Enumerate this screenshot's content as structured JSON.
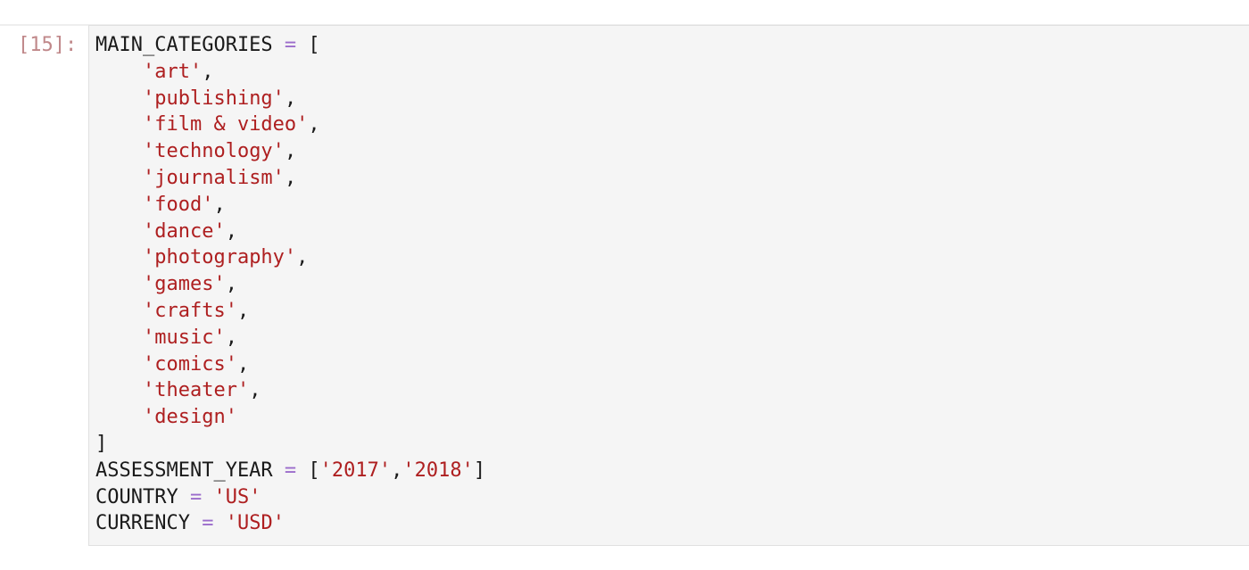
{
  "cell": {
    "prompt": "[15]:",
    "lines": [
      [
        {
          "t": "MAIN_CATEGORIES ",
          "c": "pn"
        },
        {
          "t": "=",
          "c": "op"
        },
        {
          "t": " [",
          "c": "pn"
        }
      ],
      [
        {
          "t": "    ",
          "c": "pn"
        },
        {
          "t": "'art'",
          "c": "str"
        },
        {
          "t": ",",
          "c": "pn"
        }
      ],
      [
        {
          "t": "    ",
          "c": "pn"
        },
        {
          "t": "'publishing'",
          "c": "str"
        },
        {
          "t": ",",
          "c": "pn"
        }
      ],
      [
        {
          "t": "    ",
          "c": "pn"
        },
        {
          "t": "'film & video'",
          "c": "str"
        },
        {
          "t": ",",
          "c": "pn"
        }
      ],
      [
        {
          "t": "    ",
          "c": "pn"
        },
        {
          "t": "'technology'",
          "c": "str"
        },
        {
          "t": ",",
          "c": "pn"
        }
      ],
      [
        {
          "t": "    ",
          "c": "pn"
        },
        {
          "t": "'journalism'",
          "c": "str"
        },
        {
          "t": ",",
          "c": "pn"
        }
      ],
      [
        {
          "t": "    ",
          "c": "pn"
        },
        {
          "t": "'food'",
          "c": "str"
        },
        {
          "t": ",",
          "c": "pn"
        }
      ],
      [
        {
          "t": "    ",
          "c": "pn"
        },
        {
          "t": "'dance'",
          "c": "str"
        },
        {
          "t": ",",
          "c": "pn"
        }
      ],
      [
        {
          "t": "    ",
          "c": "pn"
        },
        {
          "t": "'photography'",
          "c": "str"
        },
        {
          "t": ",",
          "c": "pn"
        }
      ],
      [
        {
          "t": "    ",
          "c": "pn"
        },
        {
          "t": "'games'",
          "c": "str"
        },
        {
          "t": ",",
          "c": "pn"
        }
      ],
      [
        {
          "t": "    ",
          "c": "pn"
        },
        {
          "t": "'crafts'",
          "c": "str"
        },
        {
          "t": ",",
          "c": "pn"
        }
      ],
      [
        {
          "t": "    ",
          "c": "pn"
        },
        {
          "t": "'music'",
          "c": "str"
        },
        {
          "t": ",",
          "c": "pn"
        }
      ],
      [
        {
          "t": "    ",
          "c": "pn"
        },
        {
          "t": "'comics'",
          "c": "str"
        },
        {
          "t": ",",
          "c": "pn"
        }
      ],
      [
        {
          "t": "    ",
          "c": "pn"
        },
        {
          "t": "'theater'",
          "c": "str"
        },
        {
          "t": ",",
          "c": "pn"
        }
      ],
      [
        {
          "t": "    ",
          "c": "pn"
        },
        {
          "t": "'design'",
          "c": "str"
        }
      ],
      [
        {
          "t": "]",
          "c": "pn"
        }
      ],
      [
        {
          "t": "ASSESSMENT_YEAR ",
          "c": "pn"
        },
        {
          "t": "=",
          "c": "op"
        },
        {
          "t": " [",
          "c": "pn"
        },
        {
          "t": "'2017'",
          "c": "str"
        },
        {
          "t": ",",
          "c": "pn"
        },
        {
          "t": "'2018'",
          "c": "str"
        },
        {
          "t": "]",
          "c": "pn"
        }
      ],
      [
        {
          "t": "COUNTRY ",
          "c": "pn"
        },
        {
          "t": "=",
          "c": "op"
        },
        {
          "t": " ",
          "c": "pn"
        },
        {
          "t": "'US'",
          "c": "str"
        }
      ],
      [
        {
          "t": "CURRENCY ",
          "c": "pn"
        },
        {
          "t": "=",
          "c": "op"
        },
        {
          "t": " ",
          "c": "pn"
        },
        {
          "t": "'USD'",
          "c": "str"
        }
      ]
    ]
  },
  "colors": {
    "string": "#ae1f20",
    "operator": "#9b6ccb",
    "text": "#1a1a1a",
    "prompt": "#c0888a",
    "cell_background": "#f5f5f5",
    "cell_border": "#e0e0e0"
  }
}
